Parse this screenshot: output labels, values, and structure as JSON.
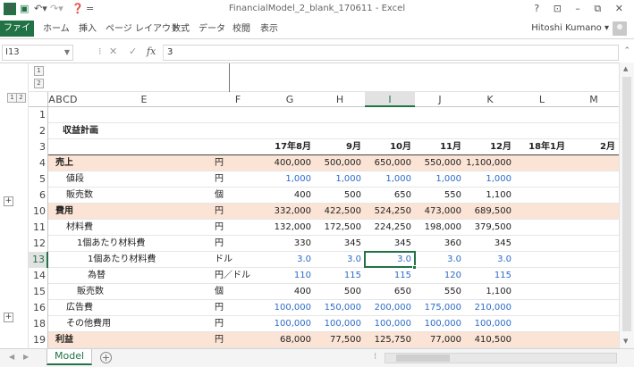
{
  "window": {
    "doc_title": "FinancialModel_2_blank_170611 - Excel",
    "controls": "? ⊡ – ⧉ ✕",
    "qa_more": "="
  },
  "ribbon": {
    "tabs": [
      "ファイル",
      "ホーム",
      "挿入",
      "ページ レイアウト",
      "数式",
      "データ",
      "校閲",
      "表示"
    ],
    "user": "Hitoshi Kumano ▾"
  },
  "formula_bar": {
    "name_box": "I13",
    "separator": "⁝",
    "cancel": "✕",
    "enter": "✓",
    "fx": "fx",
    "content": "3"
  },
  "outline": {
    "col_levels": [
      "1",
      "2"
    ],
    "row_levels": [
      "1",
      "2"
    ],
    "group_buttons": [
      "+",
      "+"
    ]
  },
  "columns": [
    {
      "id": "A",
      "label": "A"
    },
    {
      "id": "B",
      "label": "B"
    },
    {
      "id": "C",
      "label": "C"
    },
    {
      "id": "D",
      "label": "D"
    },
    {
      "id": "E",
      "label": "E"
    },
    {
      "id": "F",
      "label": "F"
    },
    {
      "id": "G",
      "label": "G"
    },
    {
      "id": "H",
      "label": "H"
    },
    {
      "id": "I",
      "label": "I"
    },
    {
      "id": "J",
      "label": "J"
    },
    {
      "id": "K",
      "label": "K"
    },
    {
      "id": "L",
      "label": "L"
    },
    {
      "id": "M",
      "label": "M"
    }
  ],
  "selected": {
    "row": "13",
    "col": "I"
  },
  "rows": [
    {
      "n": "1",
      "style": "",
      "label": "",
      "unit": "",
      "vals": []
    },
    {
      "n": "2",
      "style": "title",
      "label": "収益計画",
      "unit": "",
      "vals": []
    },
    {
      "n": "3",
      "style": "hdr",
      "label": "",
      "unit": "",
      "vals": [
        "17年8月",
        "9月",
        "10月",
        "11月",
        "12月",
        "18年1月",
        "2月"
      ]
    },
    {
      "n": "4",
      "style": "band",
      "label": "売上",
      "indent": 0,
      "unit": "円",
      "vals": [
        "400,000",
        "500,000",
        "650,000",
        "550,000",
        "1,100,000"
      ]
    },
    {
      "n": "5",
      "style": "",
      "label": "値段",
      "indent": 1,
      "unit": "円",
      "blue": true,
      "vals": [
        "1,000",
        "1,000",
        "1,000",
        "1,000",
        "1,000"
      ]
    },
    {
      "n": "6",
      "style": "",
      "label": "販売数",
      "indent": 1,
      "unit": "個",
      "vals": [
        "400",
        "500",
        "650",
        "550",
        "1,100"
      ]
    },
    {
      "n": "10",
      "style": "band",
      "label": "費用",
      "indent": 0,
      "unit": "円",
      "vals": [
        "332,000",
        "422,500",
        "524,250",
        "473,000",
        "689,500"
      ]
    },
    {
      "n": "11",
      "style": "",
      "label": "材料費",
      "indent": 1,
      "unit": "円",
      "vals": [
        "132,000",
        "172,500",
        "224,250",
        "198,000",
        "379,500"
      ]
    },
    {
      "n": "12",
      "style": "",
      "label": "1個あたり材料費",
      "indent": 2,
      "unit": "円",
      "vals": [
        "330",
        "345",
        "345",
        "360",
        "345"
      ]
    },
    {
      "n": "13",
      "style": "",
      "label": "1個あたり材料費",
      "indent": 3,
      "unit": "ドル",
      "blue": true,
      "vals": [
        "3.0",
        "3.0",
        "3.0",
        "3.0",
        "3.0"
      ]
    },
    {
      "n": "14",
      "style": "",
      "label": "為替",
      "indent": 3,
      "unit": "円／ドル",
      "blue": true,
      "vals": [
        "110",
        "115",
        "115",
        "120",
        "115"
      ]
    },
    {
      "n": "15",
      "style": "",
      "label": "販売数",
      "indent": 2,
      "unit": "個",
      "vals": [
        "400",
        "500",
        "650",
        "550",
        "1,100"
      ]
    },
    {
      "n": "16",
      "style": "",
      "label": "広告費",
      "indent": 1,
      "unit": "円",
      "blue": true,
      "vals": [
        "100,000",
        "150,000",
        "200,000",
        "175,000",
        "210,000"
      ]
    },
    {
      "n": "18",
      "style": "",
      "label": "その他費用",
      "indent": 1,
      "unit": "円",
      "blue": true,
      "vals": [
        "100,000",
        "100,000",
        "100,000",
        "100,000",
        "100,000"
      ]
    },
    {
      "n": "19",
      "style": "band",
      "label": "利益",
      "indent": 0,
      "unit": "円",
      "vals": [
        "68,000",
        "77,500",
        "125,750",
        "77,000",
        "410,500"
      ]
    }
  ],
  "sheets": {
    "active": "Model",
    "add": "+"
  }
}
